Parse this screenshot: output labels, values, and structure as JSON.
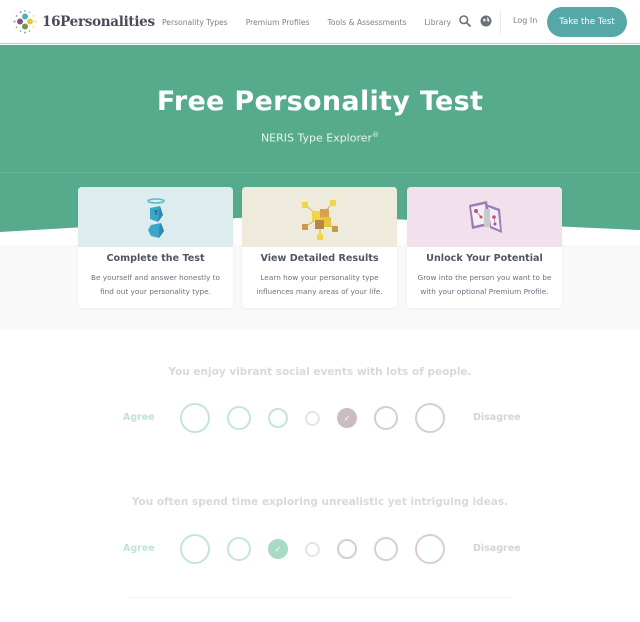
{
  "header": {
    "logo_text": "16Personalities",
    "nav": [
      "Personality Types",
      "Premium Profiles",
      "Tools & Assessments",
      "Library"
    ],
    "search_icon": "search-icon",
    "language_icon": "globe-icon",
    "login_label": "Log In",
    "cta_label": "Take the Test"
  },
  "hero": {
    "title": "Free Personality Test",
    "subtitle": "NERIS Type Explorer",
    "subtitle_mark": "®"
  },
  "cards": [
    {
      "title": "Complete the Test",
      "text": "Be yourself and answer honestly to find out your personality type.",
      "icon": "test-cube-halo-icon"
    },
    {
      "title": "View Detailed Results",
      "text": "Learn how your personality type influences many areas of your life.",
      "icon": "results-cubes-icon"
    },
    {
      "title": "Unlock Your Potential",
      "text": "Grow into the person you want to be with your optional Premium Profile.",
      "icon": "premium-map-icon"
    }
  ],
  "questions": [
    {
      "text": "You enjoy vibrant social events with lots of people.",
      "agree_label": "Agree",
      "disagree_label": "Disagree",
      "selected_index": 4,
      "options_count": 7
    },
    {
      "text": "You often spend time exploring unrealistic yet intriguing ideas.",
      "agree_label": "Agree",
      "disagree_label": "Disagree",
      "selected_index": 2,
      "options_count": 7
    }
  ],
  "colors": {
    "brand_green": "#55ab8b",
    "cta_teal": "#56a8a8",
    "agree_color": "#a9dac5",
    "disagree_color": "#cbbcc4"
  }
}
